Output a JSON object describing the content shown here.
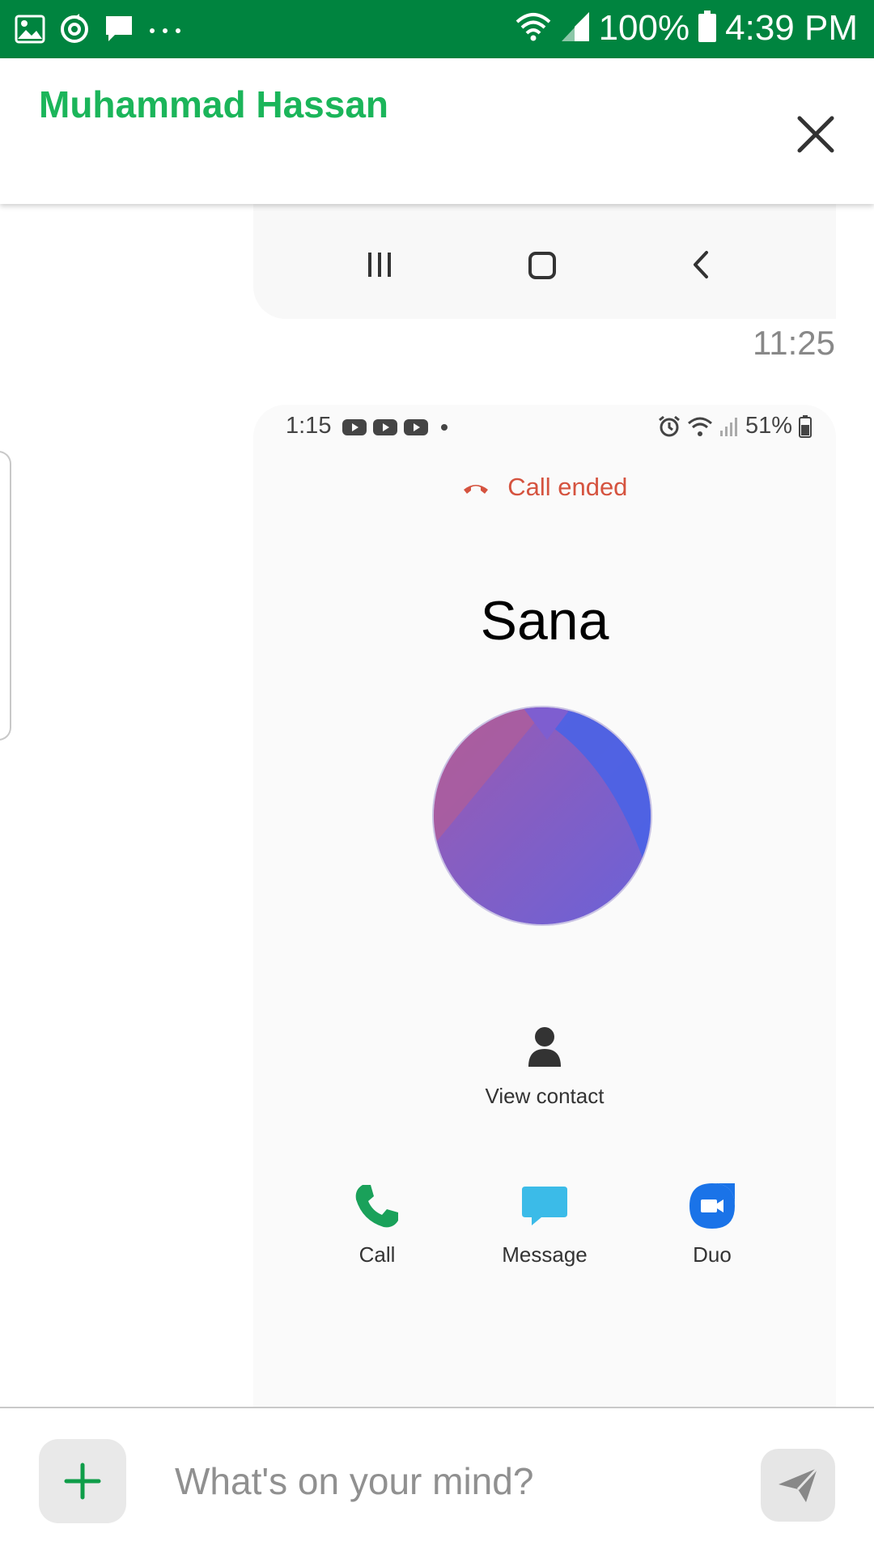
{
  "status_bar": {
    "battery": "100%",
    "time": "4:39 PM",
    "left_icons": [
      "image-icon",
      "sync-icon",
      "chat-bubble-icon",
      "more-dots-icon"
    ],
    "right_icons": [
      "wifi-icon",
      "signal-icon",
      "battery-icon"
    ],
    "background": "#00843f"
  },
  "header": {
    "title": "Muhammad Hassan",
    "title_color": "#1bb55a",
    "close_icon": "close-icon"
  },
  "conversation": {
    "message_time": "11:25",
    "previous_screenshot": {
      "nav_icons": [
        "recent-apps-icon",
        "home-icon",
        "back-icon"
      ]
    },
    "screenshot": {
      "status_time": "1:15",
      "status_battery": "51%",
      "status_left_icons": [
        "youtube-icon",
        "youtube-icon",
        "youtube-icon",
        "dot-icon"
      ],
      "status_right_icons": [
        "alarm-icon",
        "wifi-icon",
        "signal-icon",
        "battery-icon"
      ],
      "call_status": "Call ended",
      "call_status_color": "#d5533f",
      "contact_name": "Sana",
      "view_contact_label": "View contact",
      "actions": [
        {
          "label": "Call",
          "icon": "phone-icon",
          "color": "#1aa15a"
        },
        {
          "label": "Message",
          "icon": "message-icon",
          "color": "#3bbbe8"
        },
        {
          "label": "Duo",
          "icon": "video-icon",
          "color": "#1a73e8"
        }
      ]
    }
  },
  "composer": {
    "placeholder": "What's on your mind?",
    "add_icon": "plus-icon",
    "send_icon": "send-icon"
  }
}
